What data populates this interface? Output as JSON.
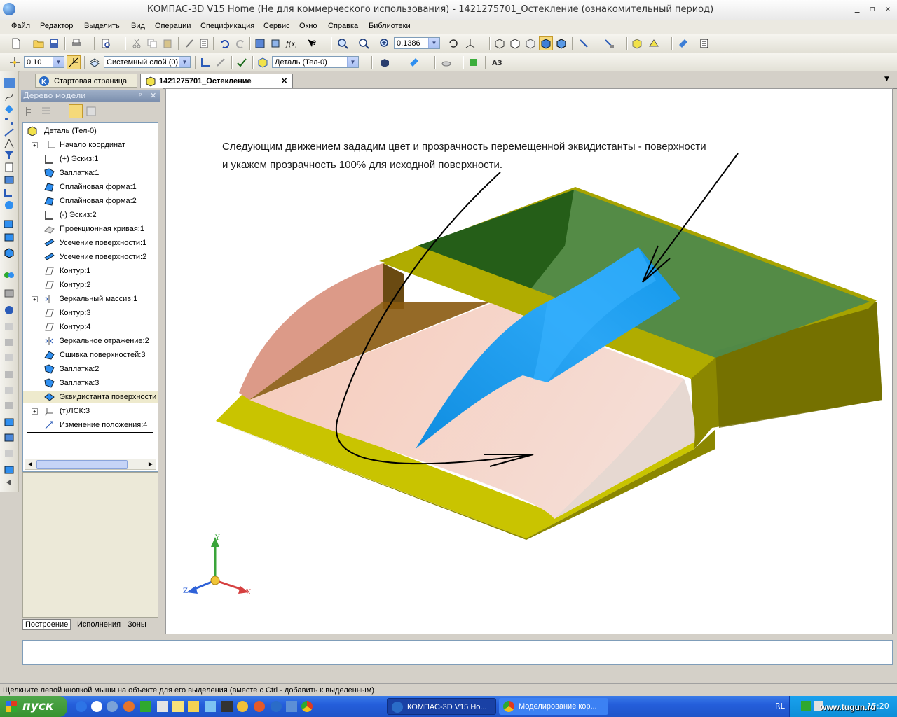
{
  "window": {
    "title": "КОМПАС-3D V15 Home (Не для коммерческого использования) - 1421275701_Остекление (ознакомительный период)"
  },
  "menu": [
    "Файл",
    "Редактор",
    "Выделить",
    "Вид",
    "Операции",
    "Спецификация",
    "Сервис",
    "Окно",
    "Справка",
    "Библиотеки"
  ],
  "toolbar1": {
    "zoom_value": "0.1386"
  },
  "toolbar2": {
    "step_value": "0.10",
    "layer_value": "Системный слой (0)",
    "detail_value": "Деталь (Тел-0)"
  },
  "tabs": [
    {
      "label": "Стартовая страница",
      "active": false
    },
    {
      "label": "1421275701_Остекление",
      "active": true,
      "close": "✕"
    }
  ],
  "tree_panel": {
    "title": "Дерево модели",
    "pin": "ᵖ",
    "close": "✕",
    "root": "Деталь (Тел-0)",
    "items": [
      {
        "label": "Начало координат",
        "expandable": true
      },
      {
        "label": "(+) Эскиз:1",
        "expandable": false
      },
      {
        "label": "Заплатка:1",
        "expandable": false
      },
      {
        "label": "Сплайновая форма:1",
        "expandable": false
      },
      {
        "label": "Сплайновая форма:2",
        "expandable": false
      },
      {
        "label": "(-) Эскиз:2",
        "expandable": false
      },
      {
        "label": "Проекционная кривая:1",
        "expandable": false
      },
      {
        "label": "Усечение поверхности:1",
        "expandable": false
      },
      {
        "label": "Усечение поверхности:2",
        "expandable": false
      },
      {
        "label": "Контур:1",
        "expandable": false
      },
      {
        "label": "Контур:2",
        "expandable": false
      },
      {
        "label": "Зеркальный массив:1",
        "expandable": true
      },
      {
        "label": "Контур:3",
        "expandable": false
      },
      {
        "label": "Контур:4",
        "expandable": false
      },
      {
        "label": "Зеркальное отражение:2",
        "expandable": false
      },
      {
        "label": "Сшивка поверхностей:3",
        "expandable": false
      },
      {
        "label": "Заплатка:2",
        "expandable": false
      },
      {
        "label": "Заплатка:3",
        "expandable": false
      },
      {
        "label": "Эквидистанта поверхности",
        "expandable": false,
        "selected": true
      },
      {
        "label": "(т)ЛСК:3",
        "expandable": true
      },
      {
        "label": "Изменение положения:4",
        "expandable": false
      }
    ],
    "bottom_tabs": [
      "Построение",
      "Исполнения",
      "Зоны"
    ]
  },
  "viewport": {
    "annotation_line1": "Следующим движением зададим цвет и прозрачность перемещенной эквидистанты - поверхности",
    "annotation_line2": "и укажем прозрачность 100% для исходной поверхности.",
    "axes": {
      "x": "X",
      "y": "Y",
      "z": "Z"
    }
  },
  "status_text": "Щелкните левой кнопкой мыши на объекте для его выделения (вместе с Ctrl - добавить к выделенным)",
  "taskbar": {
    "start_label": "пуск",
    "items": [
      {
        "label": "КОМПАС-3D V15 Ho..."
      },
      {
        "label": "Моделирование кор..."
      }
    ],
    "lang": "RL",
    "clock": "15:20",
    "watermark": "www.tugun.ru"
  },
  "colors": {
    "accent_blue": "#1e9cf0",
    "body_olive": "#b8b400",
    "glass_green": "#4f8a4a",
    "surface_pink": "#f2c3b2"
  }
}
